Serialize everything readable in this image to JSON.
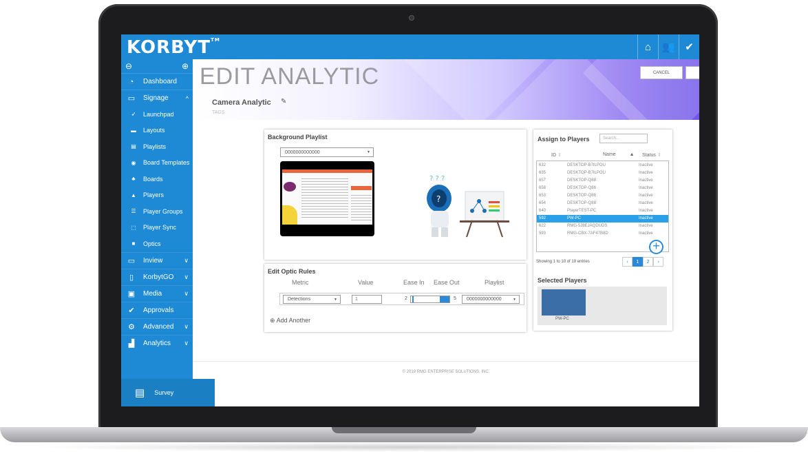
{
  "app": {
    "logo": "KORBYT",
    "trademark": "TM"
  },
  "topbar": {
    "icons": [
      "home-icon",
      "users-icon",
      "check-icon"
    ]
  },
  "sidebar": {
    "items": [
      {
        "label": "Dashboard",
        "icon": "dashboard-icon"
      },
      {
        "label": "Signage",
        "icon": "monitor-icon",
        "expanded": true
      },
      {
        "label": "Inview",
        "icon": "monitor-icon"
      },
      {
        "label": "KorbytGO",
        "icon": "tablet-icon"
      },
      {
        "label": "Media",
        "icon": "image-icon"
      },
      {
        "label": "Approvals",
        "icon": "check-circle-icon"
      },
      {
        "label": "Advanced",
        "icon": "gears-icon"
      },
      {
        "label": "Analytics",
        "icon": "chart-icon"
      }
    ],
    "signage_sub": [
      {
        "label": "Launchpad",
        "icon": "rocket-icon"
      },
      {
        "label": "Layouts",
        "icon": "layout-icon"
      },
      {
        "label": "Playlists",
        "icon": "list-icon"
      },
      {
        "label": "Board Templates",
        "icon": "template-icon"
      },
      {
        "label": "Boards",
        "icon": "boards-icon"
      },
      {
        "label": "Players",
        "icon": "player-icon"
      },
      {
        "label": "Player Groups",
        "icon": "group-icon"
      },
      {
        "label": "Player Sync",
        "icon": "sync-icon"
      },
      {
        "label": "Optics",
        "icon": "camera-icon"
      }
    ],
    "survey_label": "Survey"
  },
  "header": {
    "title": "EDIT ANALYTIC",
    "analytic_name": "Camera Analytic",
    "tags_label": "TAGS",
    "cancel_label": "CANCEL"
  },
  "background_playlist": {
    "title": "Background Playlist",
    "selected": "0000000000000"
  },
  "optic_rules": {
    "title": "Edit Optic Rules",
    "columns": [
      "Metric",
      "Value",
      "Ease In",
      "Ease Out",
      "Playlist"
    ],
    "rule": {
      "metric": "Detections",
      "value": "1",
      "ease_in": "2",
      "ease_out": "5",
      "playlist": "0000000000000"
    },
    "add_label": "Add Another"
  },
  "assign_players": {
    "title": "Assign to Players",
    "search_placeholder": "Search...",
    "columns": [
      "ID",
      "Name",
      "Status"
    ],
    "rows": [
      {
        "id": "632",
        "name": "DESKTOP-B7ILPOU",
        "status": "Inactive"
      },
      {
        "id": "635",
        "name": "DESKTOP-B7ILPOU",
        "status": "Inactive"
      },
      {
        "id": "657",
        "name": "DESKTOP-Q88",
        "status": "Inactive"
      },
      {
        "id": "658",
        "name": "DESKTOP-Q88",
        "status": "Inactive"
      },
      {
        "id": "653",
        "name": "DESKTOP-Q88",
        "status": "Inactive"
      },
      {
        "id": "654",
        "name": "DESKTOP-Q88",
        "status": "Inactive"
      },
      {
        "id": "640",
        "name": "PlayerTEST-PC",
        "status": "Inactive"
      },
      {
        "id": "592",
        "name": "PW-PC",
        "status": "Inactive",
        "selected": true
      },
      {
        "id": "622",
        "name": "RMG-5J8EJAQDUDS",
        "status": "Inactive"
      },
      {
        "id": "593",
        "name": "RMG-CBX-7AF47B8D",
        "status": "Inactive"
      }
    ],
    "showing": "Showing 1 to 10 of 19 entries",
    "pages": [
      "1",
      "2"
    ],
    "selected_title": "Selected Players",
    "selected_player": "PW-PC"
  },
  "footer": {
    "copyright": "© 2019 RMG ENTERPRISE SOLUTIONS, INC."
  },
  "colors": {
    "brand_blue": "#1e8ad6",
    "selected_row": "#2aa0e8",
    "player_tile": "#3b6ea6"
  }
}
